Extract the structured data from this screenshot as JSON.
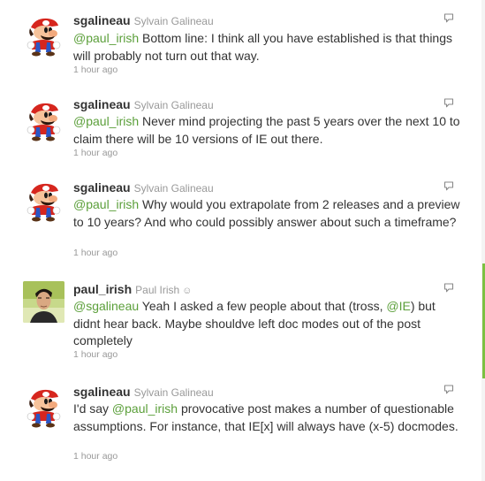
{
  "tweets": [
    {
      "screen_name": "sgalineau",
      "full_name": "Sylvain Galineau",
      "avatar": "mario-avatar",
      "segments": [
        {
          "t": "@paul_irish",
          "m": true
        },
        {
          "t": " Bottom line: I think all you have established is that things will probably not turn out that way.",
          "m": false
        }
      ],
      "time": "1 hour ago"
    },
    {
      "screen_name": "sgalineau",
      "full_name": "Sylvain Galineau",
      "avatar": "mario-avatar",
      "segments": [
        {
          "t": "@paul_irish",
          "m": true
        },
        {
          "t": " Never mind projecting the past 5 years over the next 10 to claim there will be 10 versions of IE out there.",
          "m": false
        }
      ],
      "time": "1 hour ago"
    },
    {
      "screen_name": "sgalineau",
      "full_name": "Sylvain Galineau",
      "avatar": "mario-avatar",
      "segments": [
        {
          "t": "@paul_irish",
          "m": true
        },
        {
          "t": " Why would you extrapolate from 2 releases and a preview to 10 years? And who could possibly answer about such a timeframe?",
          "m": false
        }
      ],
      "time": "1 hour ago"
    },
    {
      "screen_name": "paul_irish",
      "full_name": "Paul Irish",
      "smiley": "☺",
      "avatar": "photo-avatar",
      "segments": [
        {
          "t": "@sgalineau",
          "m": true
        },
        {
          "t": " Yeah I asked a few people about that (tross, ",
          "m": false
        },
        {
          "t": "@IE",
          "m": true
        },
        {
          "t": ") but didnt hear back. Maybe shouldve left doc modes out of the post completely",
          "m": false
        }
      ],
      "time": "1 hour ago"
    },
    {
      "screen_name": "sgalineau",
      "full_name": "Sylvain Galineau",
      "avatar": "mario-avatar",
      "segments": [
        {
          "t": "I'd say ",
          "m": false
        },
        {
          "t": "@paul_irish",
          "m": true
        },
        {
          "t": " provocative post makes a number of questionable assumptions. For instance, that IE[x] will always have (x-5) docmodes.",
          "m": false
        }
      ],
      "time": "1 hour ago"
    }
  ],
  "colors": {
    "mention": "#5b9f3a",
    "accent": "#7bc142",
    "meta": "#999999"
  },
  "icons": {
    "reply": "reply-bubble-icon"
  }
}
